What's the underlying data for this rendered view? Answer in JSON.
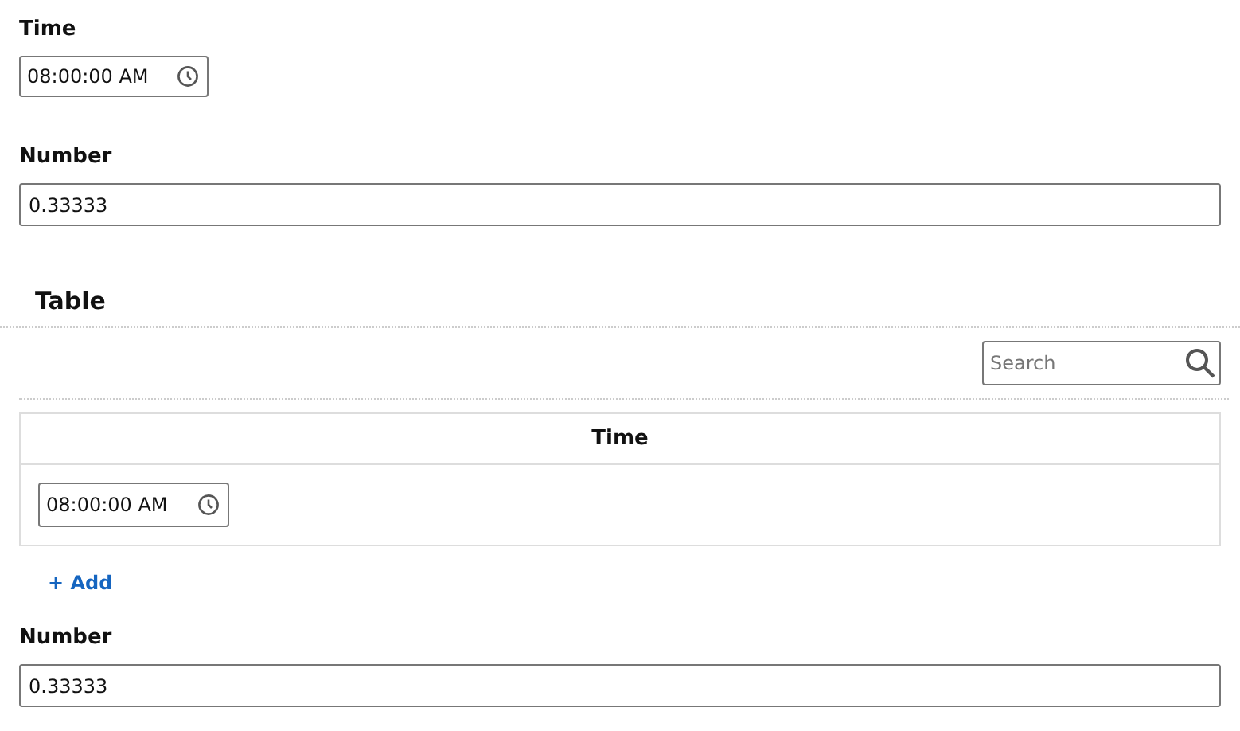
{
  "time_field": {
    "label": "Time",
    "value": "08:00:00 AM"
  },
  "number_field": {
    "label": "Number",
    "value": "0.33333"
  },
  "table": {
    "title": "Table",
    "search": {
      "placeholder": "Search"
    },
    "columns": [
      "Time"
    ],
    "rows": [
      {
        "time": "08:00:00 AM"
      }
    ],
    "add_link": "+ Add"
  },
  "number_field_2": {
    "label": "Number",
    "value": "0.33333"
  }
}
